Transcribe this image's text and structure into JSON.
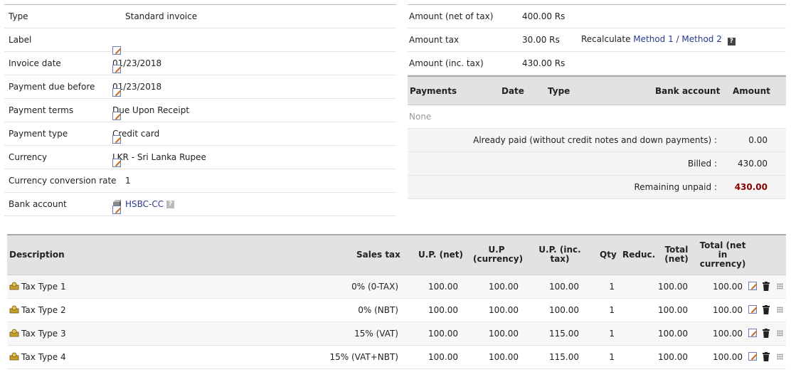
{
  "invoice": {
    "type": {
      "label": "Type",
      "value": "Standard invoice"
    },
    "label": {
      "label": "Label",
      "value": ""
    },
    "invoice_date": {
      "label": "Invoice date",
      "value": "01/23/2018"
    },
    "payment_due": {
      "label": "Payment due before",
      "value": "01/23/2018"
    },
    "payment_terms": {
      "label": "Payment terms",
      "value": "Due Upon Receipt"
    },
    "payment_type": {
      "label": "Payment type",
      "value": "Credit card"
    },
    "currency": {
      "label": "Currency",
      "value": "LKR - Sri Lanka Rupee"
    },
    "conversion_rate": {
      "label": "Currency conversion rate",
      "value": "1"
    },
    "bank_account": {
      "label": "Bank account",
      "value": "HSBC-CC"
    }
  },
  "amounts": {
    "net": {
      "label": "Amount (net of tax)",
      "value": "400.00 Rs"
    },
    "tax": {
      "label": "Amount tax",
      "value": "30.00 Rs",
      "recalc_label": "Recalculate",
      "method1": "Method 1",
      "separator": " / ",
      "method2": "Method 2"
    },
    "inc": {
      "label": "Amount (inc. tax)",
      "value": "430.00 Rs"
    }
  },
  "payments": {
    "headers": {
      "payments": "Payments",
      "date": "Date",
      "type": "Type",
      "bank": "Bank account",
      "amount": "Amount"
    },
    "none": "None",
    "already_paid": {
      "label": "Already paid (without credit notes and down payments) :",
      "value": "0.00"
    },
    "billed": {
      "label": "Billed :",
      "value": "430.00"
    },
    "remaining": {
      "label": "Remaining unpaid :",
      "value": "430.00"
    }
  },
  "lines": {
    "headers": {
      "description": "Description",
      "sales_tax": "Sales tax",
      "up_net": "U.P. (net)",
      "up_currency_1": "U.P",
      "up_currency_2": "(currency)",
      "up_inc_1": "U.P. (inc.",
      "up_inc_2": "tax)",
      "qty": "Qty",
      "reduc": "Reduc.",
      "total_net_1": "Total",
      "total_net_2": "(net)",
      "total_cur_1": "Total (net",
      "total_cur_2": "in",
      "total_cur_3": "currency)"
    },
    "rows": [
      {
        "desc": "Tax Type 1",
        "tax": "0% (0-TAX)",
        "up_net": "100.00",
        "up_cur": "100.00",
        "up_inc": "100.00",
        "qty": "1",
        "total_net": "100.00",
        "total_cur": "100.00"
      },
      {
        "desc": "Tax Type 2",
        "tax": "0% (NBT)",
        "up_net": "100.00",
        "up_cur": "100.00",
        "up_inc": "100.00",
        "qty": "1",
        "total_net": "100.00",
        "total_cur": "100.00"
      },
      {
        "desc": "Tax Type 3",
        "tax": "15% (VAT)",
        "up_net": "100.00",
        "up_cur": "100.00",
        "up_inc": "115.00",
        "qty": "1",
        "total_net": "100.00",
        "total_cur": "100.00"
      },
      {
        "desc": "Tax Type 4",
        "tax": "15% (VAT+NBT)",
        "up_net": "100.00",
        "up_cur": "100.00",
        "up_inc": "115.00",
        "qty": "1",
        "total_net": "100.00",
        "total_cur": "100.00"
      }
    ]
  }
}
